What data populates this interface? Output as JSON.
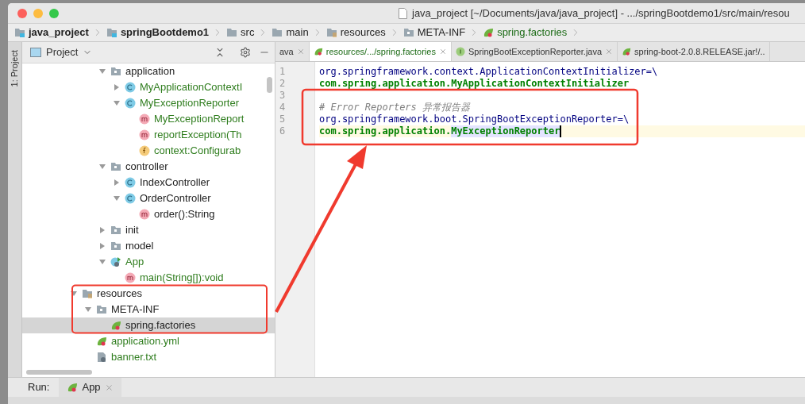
{
  "window": {
    "title": "java_project [~/Documents/java/java_project] - .../springBootdemo1/src/main/resou"
  },
  "breadcrumb": [
    {
      "label": "java_project",
      "kind": "module"
    },
    {
      "label": "springBootdemo1",
      "kind": "module"
    },
    {
      "label": "src",
      "kind": "folder"
    },
    {
      "label": "main",
      "kind": "folder"
    },
    {
      "label": "resources",
      "kind": "resources"
    },
    {
      "label": "META-INF",
      "kind": "package"
    },
    {
      "label": "spring.factories",
      "kind": "spring"
    }
  ],
  "side_stripe": {
    "label": "1: Project"
  },
  "project": {
    "title": "Project",
    "scrolled_items": [
      {
        "label": "application",
        "kind": "package",
        "expanded": true,
        "added": false,
        "selected": false,
        "children": [
          {
            "label": "MyApplicationContextI",
            "kind": "class",
            "expanded": false,
            "added": true,
            "selected": false
          },
          {
            "label": "MyExceptionReporter",
            "kind": "class",
            "expanded": true,
            "added": true,
            "selected": false,
            "children": [
              {
                "label": "MyExceptionReport",
                "kind": "method",
                "added": true,
                "selected": false
              },
              {
                "label": "reportException(Th",
                "kind": "method",
                "added": true,
                "selected": false
              },
              {
                "label": "context:Configurab",
                "kind": "field",
                "added": true,
                "selected": false
              }
            ]
          }
        ]
      },
      {
        "label": "controller",
        "kind": "package",
        "expanded": true,
        "added": false,
        "selected": false,
        "children": [
          {
            "label": "IndexController",
            "kind": "class",
            "expanded": false,
            "added": false,
            "selected": false
          },
          {
            "label": "OrderController",
            "kind": "class",
            "expanded": true,
            "added": false,
            "selected": false,
            "children": [
              {
                "label": "order():String",
                "kind": "method",
                "added": false,
                "selected": false
              }
            ]
          }
        ]
      },
      {
        "label": "init",
        "kind": "package",
        "expanded": false,
        "added": false,
        "selected": false
      },
      {
        "label": "model",
        "kind": "package",
        "expanded": false,
        "added": false,
        "selected": false
      },
      {
        "label": "App",
        "kind": "boot",
        "expanded": true,
        "added": true,
        "selected": false,
        "children": [
          {
            "label": "main(String[]):void",
            "kind": "method",
            "added": true,
            "selected": false
          }
        ]
      }
    ],
    "items": [
      {
        "label": "resources",
        "kind": "resources",
        "expanded": true,
        "added": false,
        "selected": false,
        "children": [
          {
            "label": "META-INF",
            "kind": "package",
            "expanded": true,
            "added": false,
            "selected": false,
            "children": [
              {
                "label": "spring.factories",
                "kind": "spring",
                "added": false,
                "selected": true
              }
            ]
          },
          {
            "label": "application.yml",
            "kind": "spring",
            "added": true,
            "selected": false
          },
          {
            "label": "banner.txt",
            "kind": "text",
            "added": true,
            "selected": false
          }
        ]
      }
    ]
  },
  "editor": {
    "tabs": [
      {
        "label": "ava",
        "kind": "plain",
        "selected": false,
        "closable": true
      },
      {
        "label": "resources/.../spring.factories",
        "kind": "spring",
        "selected": true,
        "closable": true
      },
      {
        "label": "SpringBootExceptionReporter.java",
        "kind": "interface",
        "selected": false,
        "closable": true
      },
      {
        "label": "spring-boot-2.0.8.RELEASE.jar!/..",
        "kind": "spring",
        "selected": false,
        "closable": false
      }
    ],
    "lines": [
      {
        "number": "1",
        "current": false,
        "parts": [
          {
            "text": "org.springframework.context.ApplicationContextInitializer=\\",
            "kind": "key",
            "highlighted": false
          }
        ]
      },
      {
        "number": "2",
        "current": false,
        "parts": [
          {
            "text": "com.spring.application.MyApplicationContextInitializer",
            "kind": "value",
            "highlighted": false
          }
        ]
      },
      {
        "number": "3",
        "current": false
      },
      {
        "number": "4",
        "current": false,
        "parts": [
          {
            "text": "# Error Reporters 异常报告器",
            "kind": "comment",
            "highlighted": false
          }
        ]
      },
      {
        "number": "5",
        "current": false,
        "parts": [
          {
            "text": "org.springframework.boot.SpringBootExceptionReporter=\\",
            "kind": "key",
            "highlighted": false
          }
        ]
      },
      {
        "number": "6",
        "current": true,
        "parts": [
          {
            "text": "com.spring.application.",
            "kind": "value",
            "highlighted": false
          },
          {
            "text": "MyExceptionReporter",
            "kind": "value",
            "highlighted": true
          }
        ]
      }
    ]
  },
  "run_bar": {
    "label": "Run:",
    "tabs": [
      {
        "label": "App",
        "selected": false
      }
    ]
  }
}
